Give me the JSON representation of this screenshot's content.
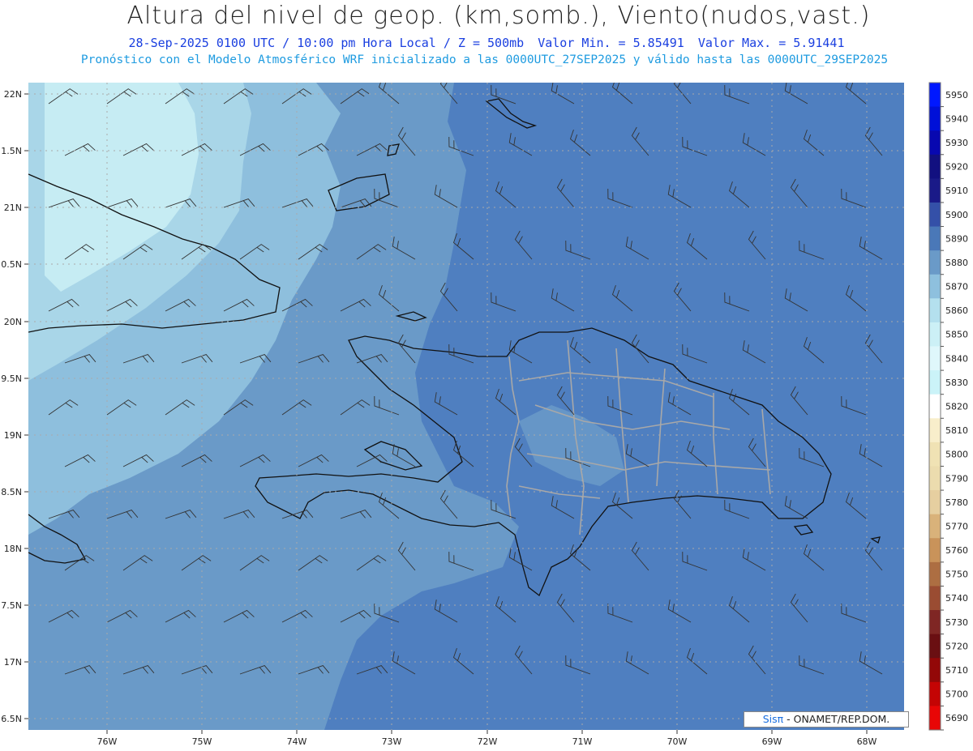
{
  "header": {
    "title": "Altura del nivel de geop. (km,somb.), Viento(nudos,vast.)",
    "date_line": "28-Sep-2025 0100 UTC / 10:00 pm Hora Local / Z = 500mb",
    "min_text": "Valor Min. = 5.85491",
    "max_text": "Valor Max. = 5.91441",
    "model_line": "Pronóstico con el Modelo Atmosférico WRF inicializado a las 0000UTC_27SEP2025 y válido hasta las  0000UTC_29SEP2025"
  },
  "axes": {
    "lat_labels": [
      "22N",
      "1.5N",
      "21N",
      "0.5N",
      "20N",
      "9.5N",
      "19N",
      "8.5N",
      "18N",
      "7.5N",
      "17N",
      "6.5N"
    ],
    "lon_labels": [
      "76W",
      "75W",
      "74W",
      "73W",
      "72W",
      "71W",
      "70W",
      "69W",
      "68W"
    ]
  },
  "colorbar": {
    "labels": [
      "5950",
      "5940",
      "5930",
      "5920",
      "5910",
      "5900",
      "5890",
      "5880",
      "5870",
      "5860",
      "5850",
      "5840",
      "5830",
      "5820",
      "5810",
      "5800",
      "5790",
      "5780",
      "5770",
      "5760",
      "5750",
      "5740",
      "5730",
      "5720",
      "5710",
      "5700",
      "5690"
    ],
    "colors": [
      "#0018ff",
      "#0010d8",
      "#0808b0",
      "#121080",
      "#1a1a88",
      "#3450a8",
      "#4a78b8",
      "#6a9ac8",
      "#8ec0de",
      "#b4e0ee",
      "#ccf0f6",
      "#dff7fb",
      "#cbf3f8",
      "#ffffff",
      "#f8eecb",
      "#f0e2b4",
      "#ecdcae",
      "#e6cfa0",
      "#d9b27a",
      "#c9935a",
      "#ad6e42",
      "#9a4c32",
      "#7f2624",
      "#6a0f12",
      "#930808",
      "#c40404",
      "#e80606"
    ]
  },
  "fields": {
    "palette": {
      "ocean": "#4f7fc0",
      "light_cyan": "#c6ecf3",
      "pale_blue": "#a9d6e8",
      "mid_blue": "#8ebfdd",
      "steel": "#6a9ac8",
      "coast": "#111111",
      "provinces": "#a8a8a8"
    }
  },
  "credit": {
    "sis": "Sis",
    "pi": "π",
    "rest": " - ONAMET/REP.DOM."
  }
}
